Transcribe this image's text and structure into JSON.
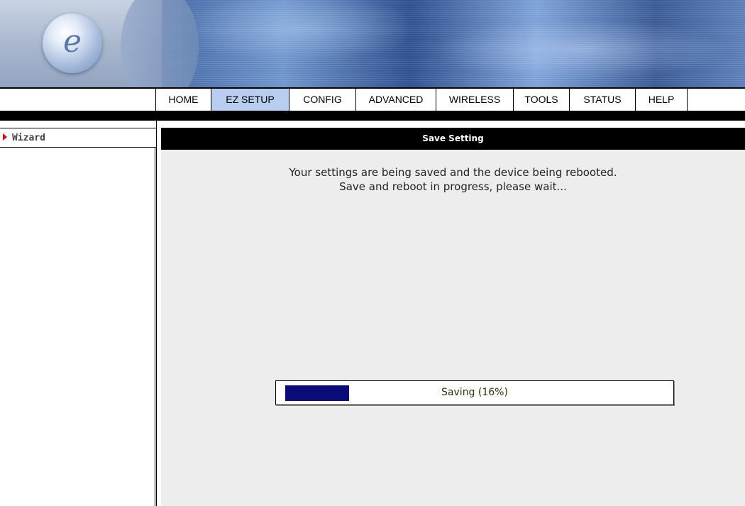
{
  "header": {
    "logo_letter": "e"
  },
  "nav": {
    "tabs": [
      {
        "label": "HOME",
        "active": false
      },
      {
        "label": "EZ SETUP",
        "active": true
      },
      {
        "label": "CONFIG",
        "active": false
      },
      {
        "label": "ADVANCED",
        "active": false
      },
      {
        "label": "WIRELESS",
        "active": false
      },
      {
        "label": "TOOLS",
        "active": false
      },
      {
        "label": "STATUS",
        "active": false
      },
      {
        "label": "HELP",
        "active": false
      }
    ]
  },
  "sidebar": {
    "items": [
      {
        "label": "Wizard"
      }
    ]
  },
  "main": {
    "section_title": "Save Setting",
    "message_line1": "Your settings are being saved and the device being rebooted.",
    "message_line2": "Save and reboot in progress, please wait..."
  },
  "progress": {
    "label": "Saving (16%)",
    "fraction": 0.16
  },
  "colors": {
    "active_tab": "#b9cdf0",
    "progress_fill": "#0b0b78",
    "wizard_arrow": "#cc1111"
  }
}
